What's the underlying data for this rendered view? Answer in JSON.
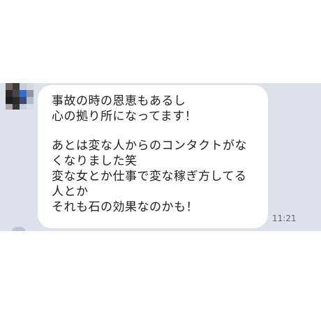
{
  "message": {
    "lines": [
      "事故の時の恩恵もあるし",
      "心の拠り所になってます！",
      "",
      "あとは変な人からのコンタクトがな",
      "くなりました笑",
      "変な女とか仕事で変な稼ぎ方してる",
      "人とか",
      "それも石の効果なのかも！"
    ],
    "time": "11:21"
  },
  "colors": {
    "chat_background": "#dde1ec",
    "bubble": "#ffffff",
    "text": "#1e1e1e",
    "timestamp": "#5f6572"
  }
}
